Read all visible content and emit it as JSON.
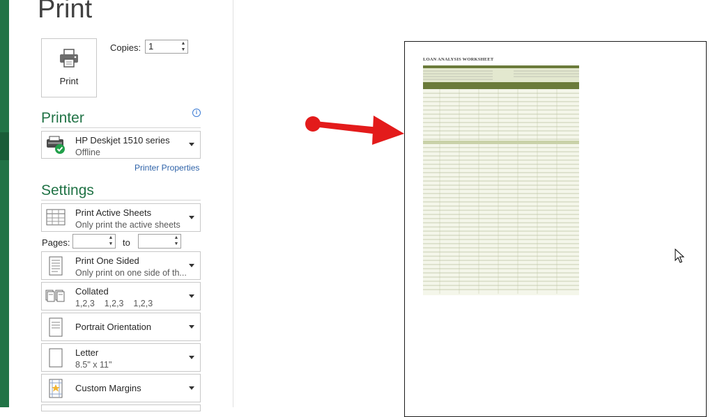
{
  "backstage": {
    "title": "Print",
    "print_button_label": "Print",
    "copies_label": "Copies:",
    "copies_value": "1"
  },
  "printer": {
    "section_title": "Printer",
    "name": "HP Deskjet 1510 series",
    "status": "Offline",
    "properties_link": "Printer Properties"
  },
  "settings": {
    "section_title": "Settings",
    "sheets": {
      "label": "Print Active Sheets",
      "sub": "Only print the active sheets"
    },
    "pages_label": "Pages:",
    "pages_from": "",
    "to_label": "to",
    "pages_to": "",
    "sides": {
      "label": "Print One Sided",
      "sub": "Only print on one side of th..."
    },
    "collation": {
      "label": "Collated",
      "sub": "1,2,3    1,2,3    1,2,3"
    },
    "orientation": {
      "label": "Portrait Orientation"
    },
    "paper": {
      "label": "Letter",
      "sub": "8.5\" x 11\""
    },
    "margins": {
      "label": "Custom Margins"
    }
  },
  "preview": {
    "worksheet_title": "LOAN ANALYSIS WORKSHEET"
  },
  "colors": {
    "accent": "#217346",
    "table_header": "#6b7b3a",
    "table_band": "#e3e8cf",
    "arrow": "#e31b1b"
  },
  "icons": {
    "print": "printer-icon",
    "printer_device": "printer-ready-icon",
    "info": "info-icon",
    "sheets": "sheets-icon",
    "one_sided": "one-sided-page-icon",
    "collated": "collated-pages-icon",
    "orientation": "portrait-page-icon",
    "paper": "letter-page-icon",
    "margins": "custom-margins-icon"
  }
}
